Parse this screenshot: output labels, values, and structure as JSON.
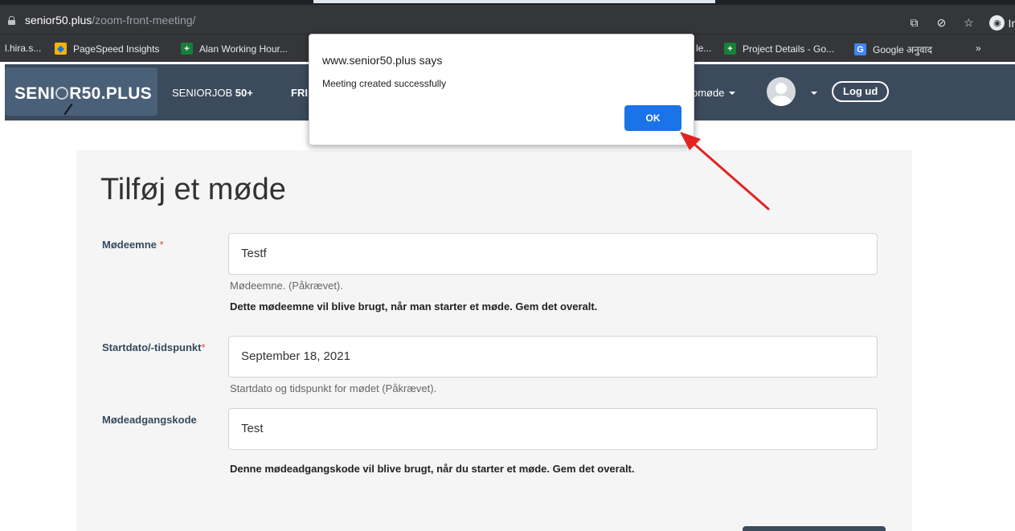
{
  "browser": {
    "url_host": "senior50.plus",
    "url_path": "/zoom-front-meeting/",
    "incognito_label": "Ir",
    "bookmarks": [
      {
        "label": "l.hira.s...",
        "icon": ""
      },
      {
        "label": "PageSpeed Insights",
        "icon": "pagespeed-icon"
      },
      {
        "label": "Alan Working Hour...",
        "icon": "sheets-icon"
      },
      {
        "label": "le...",
        "icon": ""
      },
      {
        "label": "Project Details - Go...",
        "icon": "sheets-icon"
      },
      {
        "label": "Google अनुवाद",
        "icon": "google-translate-icon"
      },
      {
        "label": "»",
        "icon": ""
      }
    ]
  },
  "site": {
    "logo_prefix": "SENI",
    "logo_suffix": "R50.PLUS",
    "nav_seniorjob_prefix": "SENIORJOB ",
    "nav_seniorjob_suffix": "50+",
    "nav_fri": "FRI",
    "nav_mode": "omøde",
    "logout": "Log ud"
  },
  "form": {
    "title": "Tilføj et møde",
    "topic_label": "Mødeemne",
    "topic_value": "Testf",
    "topic_help": "Mødeemne. (Påkrævet).",
    "topic_note": "Dette mødeemne vil blive brugt, når man starter et møde. Gem det overalt.",
    "start_label": "Startdato/-tidspunkt",
    "start_value": "September 18, 2021",
    "start_help": "Startdato og tidspunkt for mødet (Påkrævet).",
    "password_label": "Mødeadgangskode",
    "password_value": "Test",
    "password_note": "Denne mødeadgangskode vil blive brugt, når du starter et møde. Gem det overalt.",
    "required_mark": "*"
  },
  "dialog": {
    "title": "www.senior50.plus says",
    "message": "Meeting created successfully",
    "ok_label": "OK"
  },
  "colors": {
    "header_bg": "#3b4a5c",
    "ok_button": "#1a73e8",
    "annotation_arrow": "#e32222"
  }
}
